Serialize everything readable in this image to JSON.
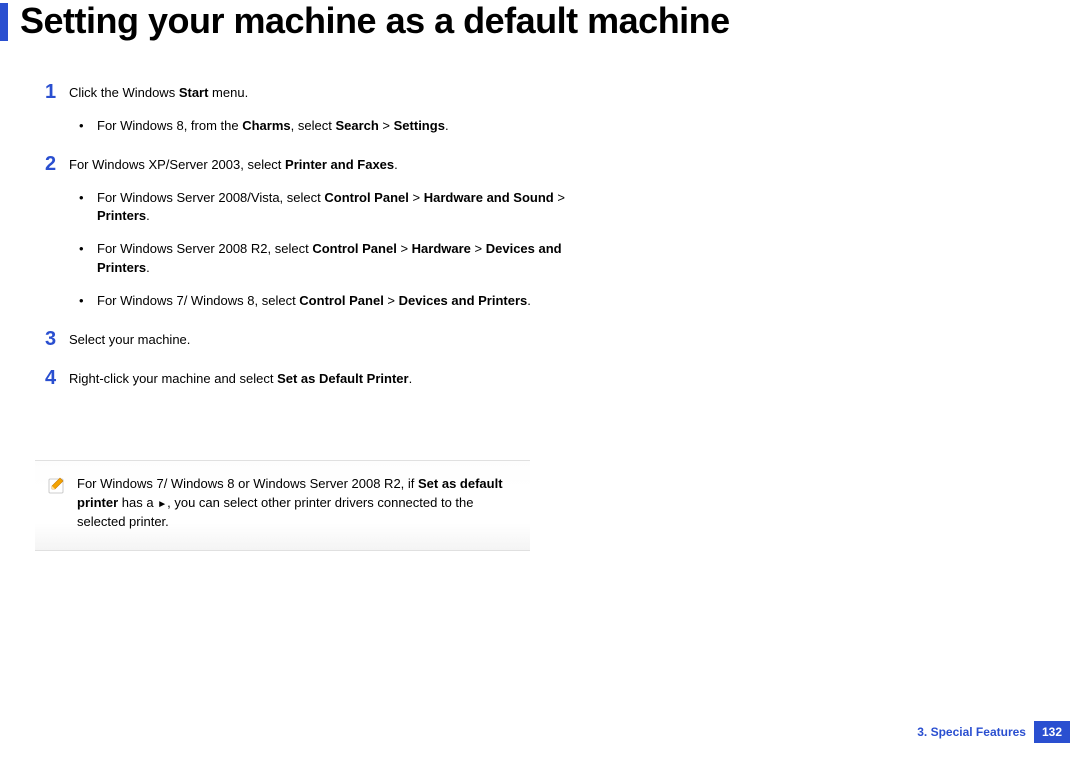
{
  "title": "Setting your machine as a default machine",
  "steps": {
    "s1": {
      "num": "1",
      "text_pre": "Click the Windows ",
      "text_bold": "Start",
      "text_post": " menu.",
      "bullets": [
        {
          "pre": "For Windows 8, from the ",
          "b1": "Charms",
          "mid": ", select ",
          "b2": "Search",
          "gt": " > ",
          "b3": "Settings",
          "post": "."
        }
      ]
    },
    "s2": {
      "num": "2",
      "text_pre": "For Windows XP/Server 2003, select ",
      "text_bold": "Printer and Faxes",
      "text_post": ".",
      "bullets": [
        {
          "pre": "For Windows Server 2008/Vista, select ",
          "b1": "Control Panel",
          "gt1": " > ",
          "b2": "Hardware and Sound",
          "gt2": " > ",
          "b3": "Printers",
          "post": "."
        },
        {
          "pre": "For Windows Server 2008 R2, select ",
          "b1": "Control Panel",
          "gt1": " > ",
          "b2": "Hardware",
          "gt2": " > ",
          "b3": "Devices and Printers",
          "post": "."
        },
        {
          "pre": "For Windows 7/ Windows 8, select ",
          "b1": "Control Panel",
          "gt1": " > ",
          "b2": "Devices and Printers",
          "post": "."
        }
      ]
    },
    "s3": {
      "num": "3",
      "text": "Select your machine."
    },
    "s4": {
      "num": "4",
      "text_pre": "Right-click your machine and select ",
      "text_bold": "Set as Default Printer",
      "text_post": "."
    }
  },
  "note": {
    "pre": "For Windows 7/ Windows 8 or Windows Server 2008 R2, if ",
    "b1": "Set as default printer",
    "mid1": " has a ",
    "glyph": "►",
    "mid2": ", you can select other printer drivers connected to the selected printer."
  },
  "footer": {
    "chapter": "3.  Special Features",
    "page": "132"
  }
}
